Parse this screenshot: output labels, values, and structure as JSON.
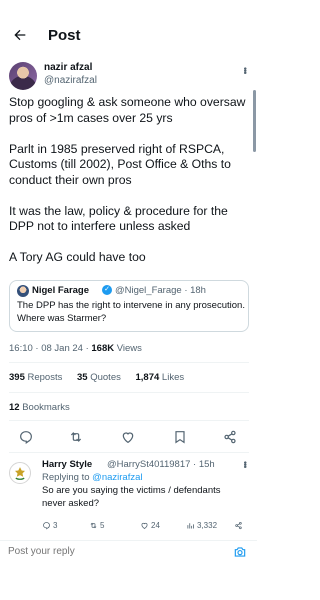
{
  "header": {
    "title": "Post"
  },
  "tweet": {
    "author_name": "nazir afzal",
    "author_handle": "@nazirafzal",
    "paragraphs": [
      "Stop googling & ask someone who oversaw pros of >1m cases over 25 yrs",
      "Parlt in 1985 preserved right of RSPCA, Customs (till 2002), Post Office & Oths to conduct their own pros",
      "It was the law, policy & procedure for the DPP not to interfere unless asked",
      "A Tory AG could have too"
    ],
    "quote": {
      "name": "Nigel Farage",
      "handle_time": "@Nigel_Farage · 18h",
      "text": "The DPP has the right to intervene in any prosecution. Where was Starmer?"
    },
    "timestamp": "16:10 · 08 Jan 24 · ",
    "views_count": "168K",
    "views_label": " Views",
    "reposts_count": "395",
    "reposts_label": " Reposts",
    "quotes_count": "35",
    "quotes_label": " Quotes",
    "likes_count": "1,874",
    "likes_label": " Likes",
    "bookmarks_count": "12",
    "bookmarks_label": " Bookmarks"
  },
  "reply": {
    "name": "Harry Style",
    "handle_time": "@HarrySt40119817 · 15h",
    "replying_prefix": "Replying to ",
    "replying_handle": "@nazirafzal",
    "text": "So are you saying the victims / defendants never asked?",
    "replies": "3",
    "reposts": "5",
    "likes": "24",
    "views": "3,332"
  },
  "compose": {
    "placeholder": "Post your reply"
  },
  "colors": {
    "accent": "#1d9bf0",
    "text": "#0f1419",
    "muted": "#536471",
    "border": "#cfd9de"
  },
  "icons": [
    "back-arrow-icon",
    "more-icon",
    "verified-icon",
    "reply-icon",
    "repost-icon",
    "like-icon",
    "bookmark-icon",
    "share-icon",
    "views-icon",
    "camera-icon"
  ]
}
